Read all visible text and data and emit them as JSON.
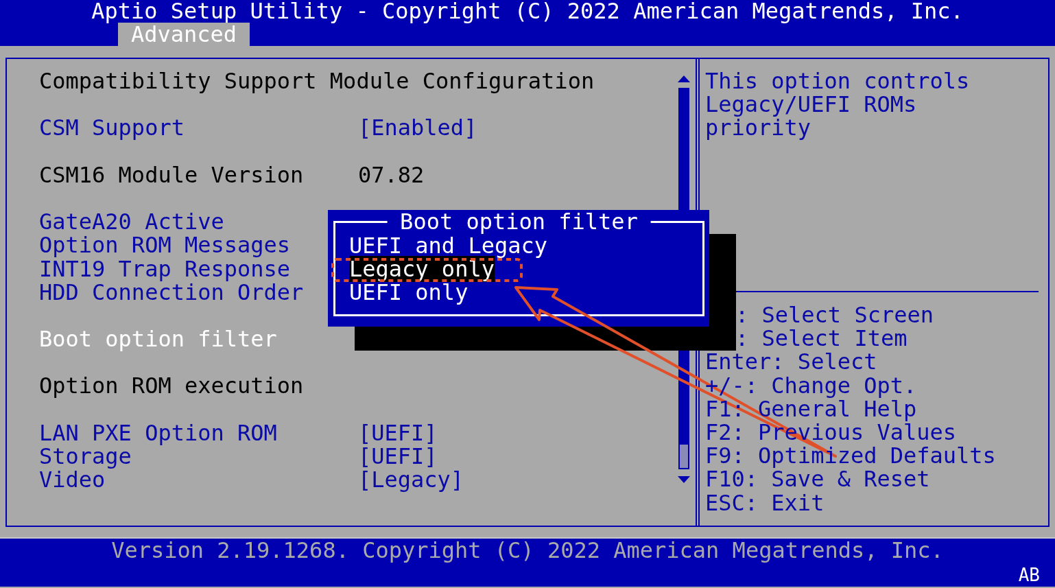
{
  "window": {
    "title": "Aptio Setup Utility - Copyright (C) 2022 American Megatrends, Inc."
  },
  "tabs": [
    {
      "label": "Advanced",
      "selected": true
    }
  ],
  "sections": [
    {
      "items": [
        {
          "kind": "title",
          "label": "Compatibility Support Module Configuration"
        }
      ]
    },
    {
      "items": [
        {
          "kind": "setting",
          "label": "CSM Support",
          "value": "[Enabled]",
          "selected": false
        }
      ]
    },
    {
      "items": [
        {
          "kind": "info",
          "label": "CSM16 Module Version",
          "value": "07.82"
        }
      ]
    },
    {
      "items": [
        {
          "kind": "setting",
          "label": "GateA20 Active",
          "selected": false
        },
        {
          "kind": "setting",
          "label": "Option ROM Messages",
          "selected": false
        },
        {
          "kind": "setting",
          "label": "INT19 Trap Response",
          "selected": false
        },
        {
          "kind": "setting",
          "label": "HDD Connection Order",
          "selected": false
        }
      ]
    },
    {
      "items": [
        {
          "kind": "setting",
          "label": "Boot option filter",
          "selected": true
        }
      ]
    },
    {
      "items": [
        {
          "kind": "info",
          "label": "Option ROM execution"
        }
      ]
    },
    {
      "items": [
        {
          "kind": "setting",
          "label": "LAN PXE Option ROM",
          "value": "[UEFI]",
          "selected": false
        },
        {
          "kind": "setting",
          "label": "Storage",
          "value": "[UEFI]",
          "selected": false
        },
        {
          "kind": "setting",
          "label": "Video",
          "value": "[Legacy]",
          "selected": false
        }
      ]
    }
  ],
  "popup": {
    "title": "Boot option filter",
    "options": [
      {
        "label": "UEFI and Legacy",
        "selected": false
      },
      {
        "label": "Legacy only",
        "selected": true
      },
      {
        "label": "UEFI only",
        "selected": false
      }
    ]
  },
  "help": [
    "This option controls",
    "Legacy/UEFI ROMs",
    "priority"
  ],
  "keys": [
    {
      "kind": "covered",
      "text": ": Select Screen"
    },
    {
      "kind": "covered",
      "text": ": Select Item"
    },
    {
      "kind": "key",
      "text": "Enter: Select"
    },
    {
      "kind": "key",
      "text": "+/-: Change Opt."
    },
    {
      "kind": "key",
      "text": "F1: General Help"
    },
    {
      "kind": "key",
      "text": "F2: Previous Values"
    },
    {
      "kind": "key",
      "text": "F9: Optimized Defaults"
    },
    {
      "kind": "key",
      "text": "F10: Save & Reset"
    },
    {
      "kind": "key",
      "text": "ESC: Exit"
    }
  ],
  "status_bar": {
    "version": "Version 2.19.1268. Copyright (C) 2022 American Megatrends, Inc.",
    "badge": "AB"
  }
}
